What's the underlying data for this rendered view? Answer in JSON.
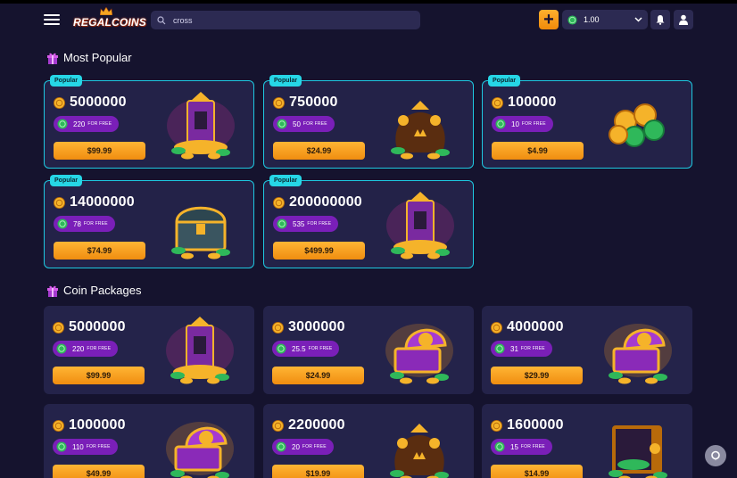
{
  "header": {
    "brand": "REGALCOINS",
    "search": {
      "value": "cross",
      "placeholder": "Search"
    },
    "balance": "1.00"
  },
  "sections": {
    "popular_title": "Most Popular",
    "packages_title": "Coin Packages"
  },
  "free_label": "FOR FREE",
  "popular": [
    {
      "badge": "Popular",
      "amount": "5000000",
      "free": "220",
      "price": "$99.99",
      "art": "treasure-pile"
    },
    {
      "badge": "Popular",
      "amount": "750000",
      "free": "50",
      "price": "$24.99",
      "art": "coin-bag"
    },
    {
      "badge": "Popular",
      "amount": "100000",
      "free": "10",
      "price": "$4.99",
      "art": "coin-stack"
    },
    {
      "badge": "Popular",
      "amount": "14000000",
      "free": "78",
      "price": "$74.99",
      "art": "treasure-chest"
    },
    {
      "badge": "Popular",
      "amount": "200000000",
      "free": "535",
      "price": "$499.99",
      "art": "treasure-pile"
    }
  ],
  "packages": [
    {
      "amount": "5000000",
      "free": "220",
      "price": "$99.99",
      "art": "treasure-pile"
    },
    {
      "amount": "3000000",
      "free": "25.5",
      "price": "$24.99",
      "art": "open-chest"
    },
    {
      "amount": "4000000",
      "free": "31",
      "price": "$29.99",
      "art": "open-chest"
    },
    {
      "amount": "1000000",
      "free": "110",
      "price": "$49.99",
      "art": "open-chest"
    },
    {
      "amount": "2200000",
      "free": "20",
      "price": "$19.99",
      "art": "coin-bag"
    },
    {
      "amount": "1600000",
      "free": "15",
      "price": "$14.99",
      "art": "vault"
    }
  ],
  "colors": {
    "background": "#15132e",
    "card": "#24234a",
    "popular_border": "#1ec8e0",
    "badge": "#26d6e6",
    "price_button": "#f5a01f",
    "free_pill": "#7a1fb8"
  }
}
